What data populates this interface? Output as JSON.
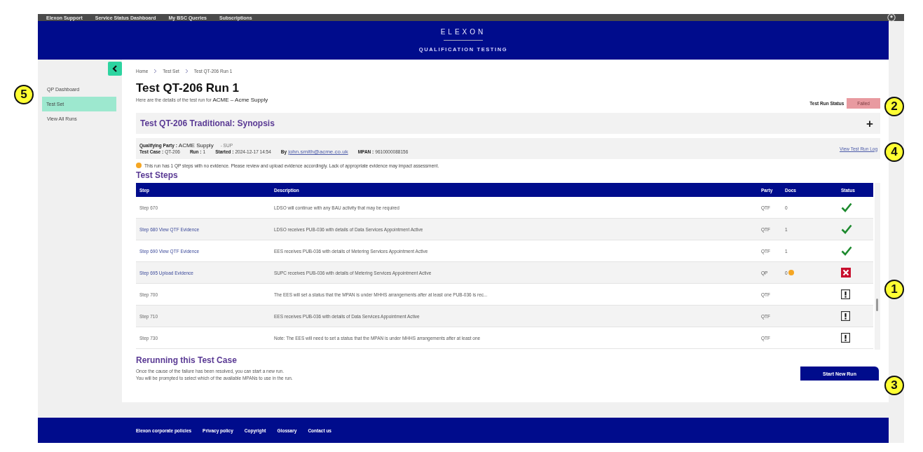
{
  "top_links": [
    "Elexon Support",
    "Service Status Dashboard",
    "My BSC Queries",
    "Subscriptions"
  ],
  "header": {
    "brand": "ELEXON",
    "subtitle": "QUALIFICATION TESTING"
  },
  "sidebar": {
    "items": [
      {
        "label": "QP Dashboard",
        "selected": false
      },
      {
        "label": "Test Set",
        "selected": true
      },
      {
        "label": "View All Runs",
        "selected": false
      }
    ]
  },
  "breadcrumbs": [
    "Home",
    "Test Set",
    "Test QT-206 Run 1"
  ],
  "page": {
    "title": "Test QT-206 Run 1",
    "subtitle_prefix": "Here are the details of the test run for",
    "subtitle_party": "ACME – Acme Supply"
  },
  "run_status": {
    "label": "Test Run Status",
    "value": "Failed"
  },
  "synopsis": {
    "title": "Test QT-206 Traditional: Synopsis",
    "toggle": "+"
  },
  "details": {
    "party_label": "Qualifying Party :",
    "party_value": "ACME Supply",
    "party_code": "- SUP",
    "test_case_label": "Test Case :",
    "test_case": "QT-206",
    "run_label": "Run :",
    "run": "1",
    "started_label": "Started :",
    "started": "2024-12-17 14:54",
    "by_label": "By",
    "by": "john.smith@acme.co.uk",
    "mpan_label": "MPAN :",
    "mpan": "9610000088156",
    "log_link": "View Test Run Log"
  },
  "warning": "This run has 1 QP steps with no evidence. Please review and upload evidence accordingly. Lack of appropriate evidence may impact assessment.",
  "steps": {
    "title": "Test Steps",
    "columns": [
      "Step",
      "Description",
      "Party",
      "Docs",
      "Status"
    ],
    "rows": [
      {
        "step": "Step 670",
        "link": false,
        "description": "LDSO will continue with any BAU activity that may be required",
        "party": "QTF",
        "docs": "0",
        "kind": "passed"
      },
      {
        "step": "Step 680 View QTF Evidence",
        "link": true,
        "description": "LDSO receives PUB-036 with details of Data Services Appointment Active",
        "party": "QTF",
        "docs": "1",
        "docs_warning": false,
        "kind": "passed"
      },
      {
        "step": "Step 690 View QTF Evidence",
        "link": true,
        "description": "EES receives PUB-036 with details of Metering Services Appointment Active",
        "party": "QTF",
        "docs": "1",
        "docs_warning": false,
        "kind": "passed"
      },
      {
        "step": "Step 695 Upload Evidence",
        "link": true,
        "description": "SUPC receives PUB-036 with details of Metering Services Appointment Active",
        "party": "QP",
        "docs": "0",
        "docs_warning": true,
        "kind": "failed"
      },
      {
        "step": "Step 700",
        "link": false,
        "description": "The EES will set a status that the MPAN is under MHHS arrangements after at least one PUB-036 is rec...",
        "party": "QTF",
        "kind": "pending"
      },
      {
        "step": "Step 710",
        "link": false,
        "description": "EES receives PUB-036 with details of Data Services Appointment Active",
        "party": "QTF",
        "kind": "pending"
      },
      {
        "step": "Step 730",
        "link": false,
        "description": "Note: The EES will need to set a status that the MPAN is under MHHS arrangements after at least one",
        "party": "QTF",
        "kind": "pending"
      }
    ]
  },
  "rerun": {
    "title": "Rerunning this Test Case",
    "lines": [
      "Once the cause of the failure has been resolved, you can start a new run.",
      "You will be prompted to select which of the available MPANs to use in the run."
    ],
    "button": "Start New Run"
  },
  "footer": [
    "Elexon corporate policies",
    "Privacy policy",
    "Copyright",
    "Glossary",
    "Contact us"
  ],
  "callouts": [
    "5",
    "2",
    "4",
    "1",
    "3"
  ]
}
